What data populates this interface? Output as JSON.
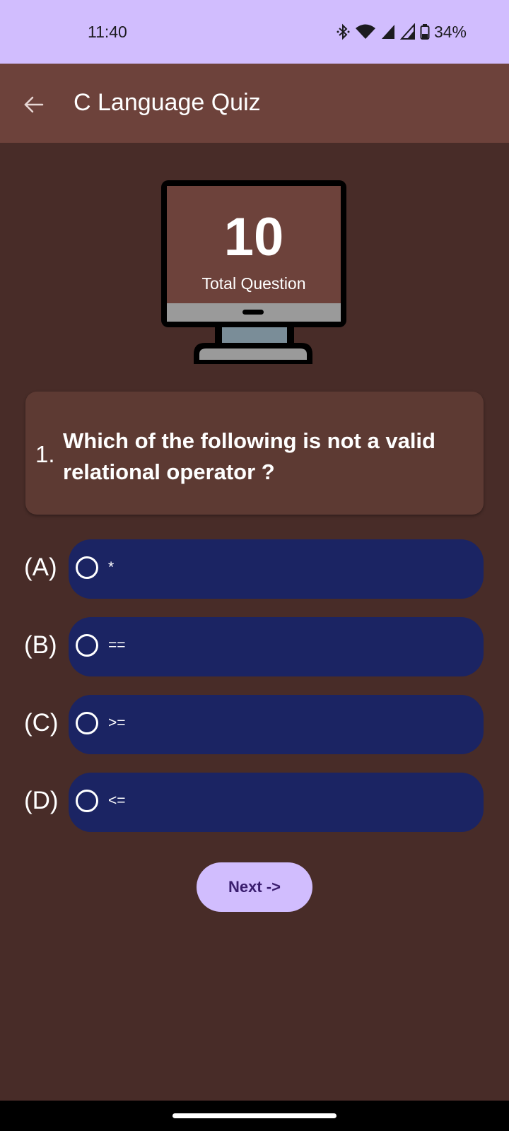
{
  "status_bar": {
    "time": "11:40",
    "battery": "34%",
    "icons": [
      "bluetooth-icon",
      "wifi-icon",
      "signal-icon",
      "signal-icon",
      "battery-icon"
    ]
  },
  "app_bar": {
    "back_icon": "arrow-left-icon",
    "title": "C Language Quiz"
  },
  "header_graphic": {
    "icon": "monitor-icon",
    "total_count": "10",
    "caption": "Total Question"
  },
  "question": {
    "number": "1.",
    "text": "Which of the following is not a valid relational operator ?"
  },
  "options": [
    {
      "label": "(A)",
      "text": "*"
    },
    {
      "label": "(B)",
      "text": "=="
    },
    {
      "label": "(C)",
      "text": ">="
    },
    {
      "label": "(D)",
      "text": "<="
    }
  ],
  "next_button": {
    "label": "Next ->"
  },
  "colors": {
    "background": "#482c28",
    "app_bar": "#6d423b",
    "status_bar": "#d1bdfe",
    "card": "#5d3a33",
    "option_pill": "#1b2463",
    "button": "#d1bdfe"
  }
}
